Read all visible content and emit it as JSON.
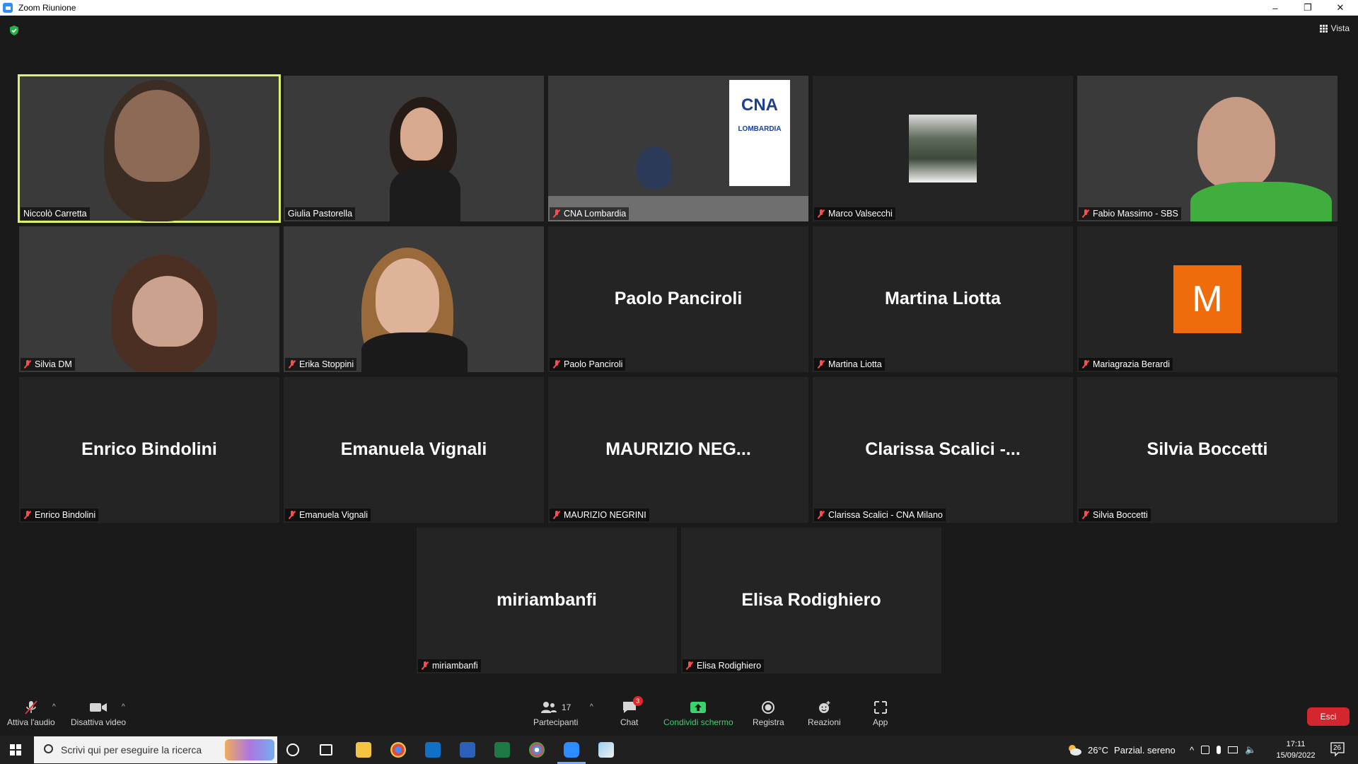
{
  "window": {
    "title": "Zoom Riunione",
    "controls": {
      "minimize": "–",
      "restore": "❐",
      "close": "✕"
    }
  },
  "topbar": {
    "view_label": "Vista"
  },
  "colors": {
    "active_speaker": "#dff06b",
    "avatar_bg": "#ef6c0c",
    "leave_button": "#d3262f",
    "share_green": "#3ad26b",
    "mute_red": "#ff4d4d"
  },
  "tiles": [
    {
      "label": "Niccolò Carretta",
      "muted": false,
      "video": true,
      "active": true
    },
    {
      "label": "Giulia Pastorella",
      "muted": false,
      "video": true
    },
    {
      "label": "CNA Lombardia",
      "muted": true,
      "video": true,
      "sign": "CNA",
      "sign_sub": "LOMBARDIA"
    },
    {
      "label": "Marco Valsecchi",
      "muted": true,
      "video": false
    },
    {
      "label": "Fabio Massimo - SBS",
      "muted": true,
      "video": true
    },
    {
      "label": "Silvia DM",
      "muted": true,
      "video": true
    },
    {
      "label": "Erika Stoppini",
      "muted": true,
      "video": true
    },
    {
      "label": "Paolo Panciroli",
      "big": "Paolo Panciroli",
      "muted": true
    },
    {
      "label": "Martina Liotta",
      "big": "Martina Liotta",
      "muted": true
    },
    {
      "label": "Mariagrazia Berardi",
      "avatar": "M",
      "muted": true
    },
    {
      "label": "Enrico Bindolini",
      "big": "Enrico Bindolini",
      "muted": true
    },
    {
      "label": "Emanuela Vignali",
      "big": "Emanuela Vignali",
      "muted": true
    },
    {
      "label": "MAURIZIO NEGRINI",
      "big": "MAURIZIO  NEG...",
      "muted": true
    },
    {
      "label": "Clarissa Scalici - CNA Milano",
      "big": "Clarissa Scalici -...",
      "muted": true
    },
    {
      "label": "Silvia Boccetti",
      "big": "Silvia Boccetti",
      "muted": true
    },
    {
      "label": "miriambanfi",
      "big": "miriambanfi",
      "muted": true
    },
    {
      "label": "Elisa Rodighiero",
      "big": "Elisa Rodighiero",
      "muted": true
    }
  ],
  "toolbar": {
    "audio_label": "Attiva l'audio",
    "video_label": "Disattiva video",
    "participants_label": "Partecipanti",
    "participants_count": "17",
    "chat_label": "Chat",
    "chat_badge": "3",
    "share_label": "Condividi schermo",
    "record_label": "Registra",
    "reactions_label": "Reazioni",
    "apps_label": "App",
    "leave_label": "Esci"
  },
  "taskbar": {
    "search_placeholder": "Scrivi qui per eseguire la ricerca",
    "weather_temp": "26°C",
    "weather_desc": "Parzial. sereno",
    "time": "17:11",
    "date": "15/09/2022",
    "notifications": "26"
  }
}
